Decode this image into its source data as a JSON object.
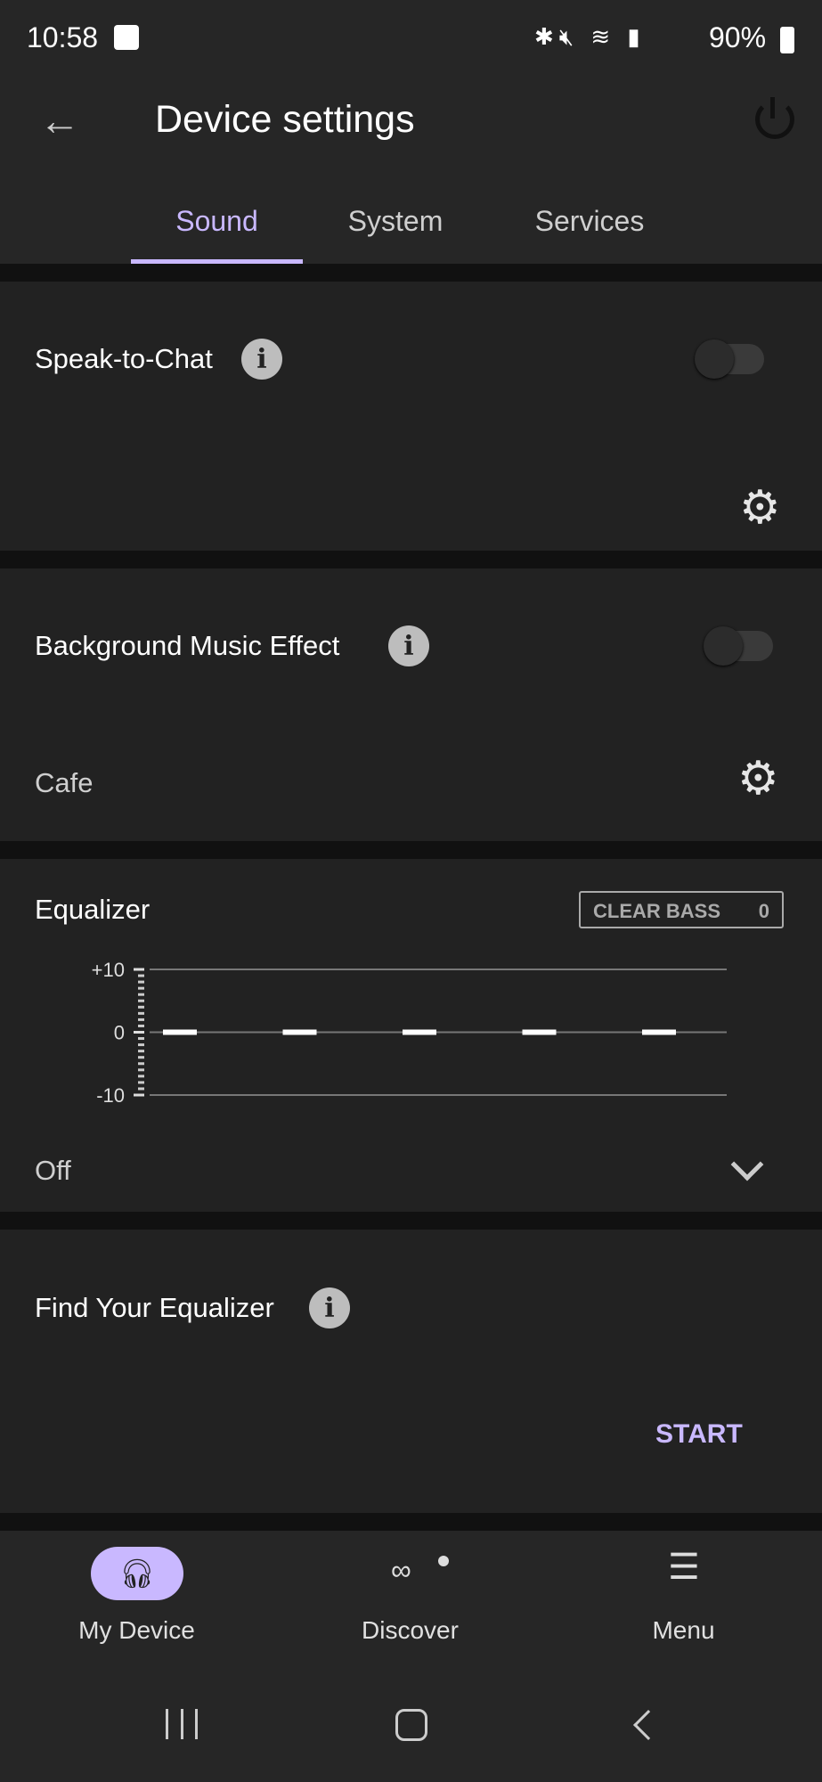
{
  "status_bar": {
    "time": "10:58",
    "battery": "90%"
  },
  "app_bar": {
    "title": "Device settings"
  },
  "tabs": [
    {
      "label": "Sound",
      "active": true
    },
    {
      "label": "System",
      "active": false
    },
    {
      "label": "Services",
      "active": false
    }
  ],
  "speak_to_chat": {
    "label": "Speak-to-Chat",
    "enabled": false
  },
  "background_music": {
    "label": "Background Music Effect",
    "enabled": false,
    "value": "Cafe"
  },
  "equalizer": {
    "label": "Equalizer",
    "clear_bass_label": "CLEAR BASS",
    "clear_bass_value": "0",
    "preset": "Off"
  },
  "chart_data": {
    "type": "bar",
    "yticks": [
      "+10",
      "0",
      "-10"
    ],
    "ylim": [
      -10,
      10
    ],
    "values": [
      0,
      0,
      0,
      0,
      0
    ]
  },
  "find_equalizer": {
    "label": "Find Your Equalizer",
    "action": "START"
  },
  "accent": "#c9b8ff",
  "bottom_nav": [
    {
      "label": "My Device",
      "icon": "headphones-speaker-icon",
      "active": true
    },
    {
      "label": "Discover",
      "icon": "binoculars-icon"
    },
    {
      "label": "Menu",
      "icon": "menu-icon"
    }
  ]
}
